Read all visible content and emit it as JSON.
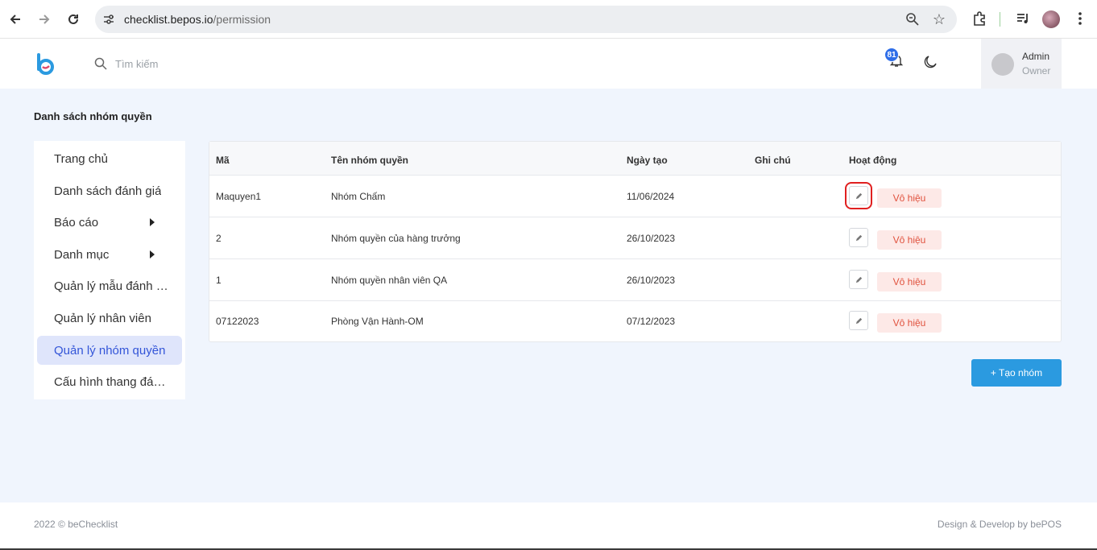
{
  "browser": {
    "url_host": "checklist.bepos.io",
    "url_path": "/permission"
  },
  "header": {
    "search_placeholder": "Tìm kiếm",
    "notification_count": "81",
    "user_name": "Admin",
    "user_role": "Owner"
  },
  "page": {
    "title": "Danh sách nhóm quyền"
  },
  "sidebar": {
    "items": [
      {
        "label": "Trang chủ"
      },
      {
        "label": "Danh sách đánh giá"
      },
      {
        "label": "Báo cáo"
      },
      {
        "label": "Danh mục"
      },
      {
        "label": "Quản lý mẫu đánh giá"
      },
      {
        "label": "Quản lý nhân viên"
      },
      {
        "label": "Quản lý nhóm quyền"
      },
      {
        "label": "Cấu hình thang đánh giá"
      }
    ]
  },
  "table": {
    "columns": [
      "Mã",
      "Tên nhóm quyền",
      "Ngày tạo",
      "Ghi chú",
      "Hoạt động"
    ],
    "rows": [
      {
        "code": "Maquyen1",
        "name": "Nhóm Chấm",
        "created": "11/06/2024",
        "note": "",
        "action": "Vô hiệu"
      },
      {
        "code": "2",
        "name": "Nhóm quyền của hàng trưởng",
        "created": "26/10/2023",
        "note": "",
        "action": "Vô hiệu"
      },
      {
        "code": "1",
        "name": "Nhóm quyền nhân viên QA",
        "created": "26/10/2023",
        "note": "",
        "action": "Vô hiệu"
      },
      {
        "code": "07122023",
        "name": "Phòng Vận Hành-OM",
        "created": "07/12/2023",
        "note": "",
        "action": "Vô hiệu"
      }
    ]
  },
  "actions": {
    "create_label": "+ Tạo nhóm"
  },
  "footer": {
    "left": "2022 © beChecklist",
    "right": "Design & Develop by bePOS"
  },
  "colors": {
    "accent": "#2b9ae0",
    "active_bg": "#dfe5fb",
    "active_text": "#3355d8",
    "danger_bg": "#fde9e7",
    "danger_text": "#e0513d",
    "badge": "#2f6ee8"
  }
}
